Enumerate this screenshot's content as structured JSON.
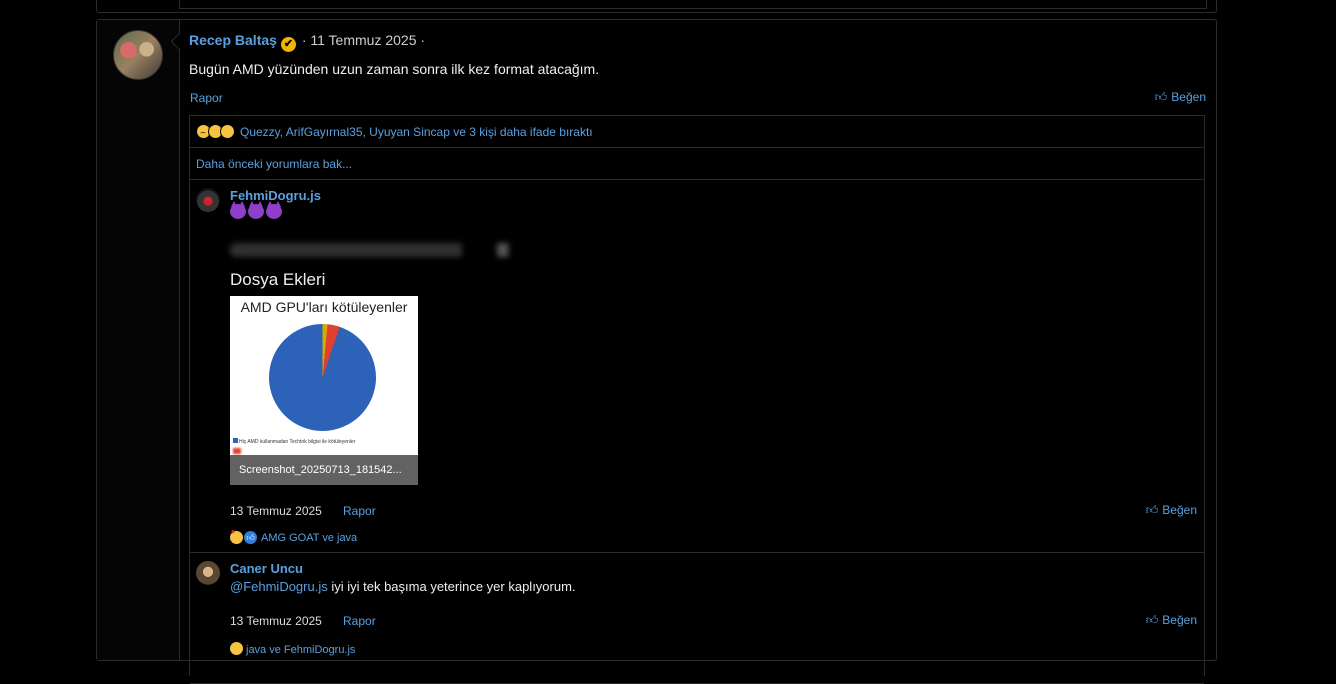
{
  "post": {
    "author": "Recep Baltaş",
    "verified_mark": "✔",
    "date": " · 11 Temmuz 2025 ·",
    "text": "Bugün AMD yüzünden uzun zaman sonra ilk kez format atacağım.",
    "report": "Rapor",
    "like": "Beğen",
    "reactions_summary": "Quezzy, ArifGayırnal35, Uyuyan Sincap ve 3 kişi daha ifade bıraktı",
    "reaction_icons": [
      "frown-emoji",
      "thinking-emoji",
      "thinking-emoji"
    ]
  },
  "comments_section": {
    "older_link": "Daha önceki yorumlara bak..."
  },
  "comment1": {
    "author": "FehmiDogru.js",
    "emojis": [
      "devil-emoji",
      "devil-emoji",
      "devil-emoji"
    ],
    "attachments_title": "Dosya Ekleri",
    "attachment": {
      "chart_title": "AMD GPU'ları kötüleyenler",
      "legend": "Hiç AMD kullanmadan Techtok bilgisi ile kötüleyenler",
      "filename": "Screenshot_20250713_181542...",
      "chart_data": {
        "type": "pie",
        "title": "AMD GPU'ları kötüleyenler",
        "categories": [
          "Hiç AMD kullanmadan Techtok bilgisi ile kötüleyenler",
          "",
          ""
        ],
        "values": [
          94.8,
          3.7,
          1.5
        ],
        "colors": [
          "#2c62b8",
          "#e04030",
          "#d4aa00"
        ]
      }
    },
    "date": "13 Temmuz 2025",
    "report": "Rapor",
    "like": "Beğen",
    "reactions": "AMG GOAT ve java"
  },
  "comment2": {
    "author": "Caner Uncu",
    "mention": "@FehmiDogru.js",
    "text": " iyi iyi tek başıma yeterince yer kaplıyorum.",
    "date": "13 Temmuz 2025",
    "report": "Rapor",
    "like": "Beğen",
    "reactions": "java ve FehmiDogru.js"
  },
  "colors": {
    "link": "#5aa0e0",
    "background": "#000000",
    "border": "#2b2b2b",
    "verified": "#f0b400"
  }
}
